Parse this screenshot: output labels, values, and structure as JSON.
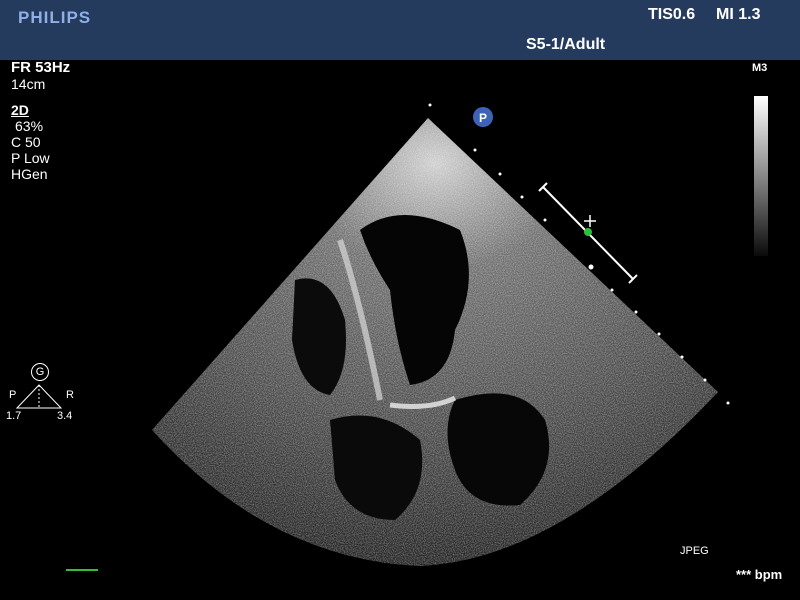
{
  "header": {
    "brand": "PHILIPS",
    "tis": "TIS0.6",
    "mi": "MI 1.3",
    "probe_preset": "S5-1/Adult"
  },
  "acquisition": {
    "frame_rate": "FR 53Hz",
    "depth": "14cm",
    "mode": "2D",
    "gain": "63%",
    "compression": "C 50",
    "power": "P Low",
    "frequency": "HGen"
  },
  "grayscale_map": "M3",
  "orientation": {
    "focus_symbol": "G",
    "left_letter": "P",
    "right_letter": "R",
    "left_value": "1.7",
    "right_value": "3.4"
  },
  "orientation_marker": "P",
  "footer": {
    "format": "JPEG",
    "heart_rate": "*** bpm"
  },
  "colors": {
    "header_bg": "#243b5e",
    "brand_text": "#8fb0e6",
    "marker_blue": "#3d62b8",
    "ecg_green": "#2fbf3a"
  }
}
